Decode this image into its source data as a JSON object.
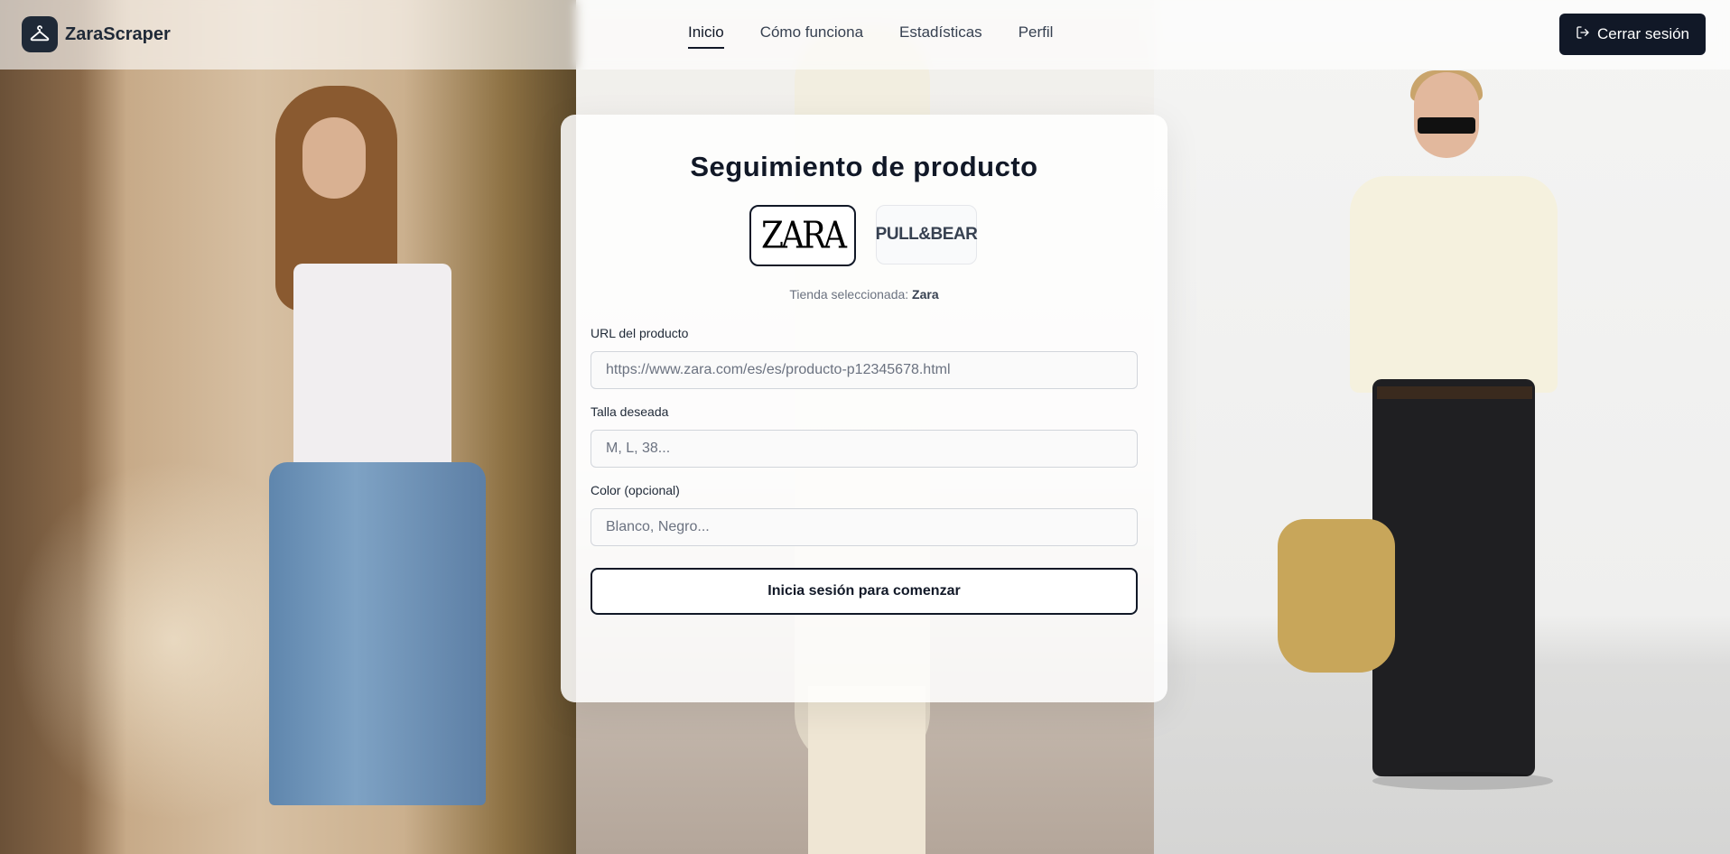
{
  "brand": {
    "name": "ZaraScraper",
    "icon": "hanger-icon"
  },
  "nav": {
    "items": [
      {
        "label": "Inicio",
        "active": true
      },
      {
        "label": "Cómo funciona",
        "active": false
      },
      {
        "label": "Estadísticas",
        "active": false
      },
      {
        "label": "Perfil",
        "active": false
      }
    ]
  },
  "header": {
    "logout_label": "Cerrar sesión",
    "logout_icon": "logout-icon"
  },
  "form": {
    "title": "Seguimiento de producto",
    "stores": [
      {
        "name": "ZARA",
        "selected": true
      },
      {
        "name": "PULL&BEAR",
        "selected": false
      }
    ],
    "selected_prefix": "Tienda seleccionada:",
    "selected_store": "Zara",
    "url_label": "URL del producto",
    "url_placeholder": "https://www.zara.com/es/es/producto-p12345678.html",
    "size_label": "Talla deseada",
    "size_placeholder": "M, L, 38...",
    "color_label": "Color (opcional)",
    "color_placeholder": "Blanco, Negro...",
    "submit_label": "Inicia sesión para comenzar"
  },
  "colors": {
    "primary": "#111827",
    "card_bg": "#ffffff",
    "text_muted": "#6b7280"
  }
}
